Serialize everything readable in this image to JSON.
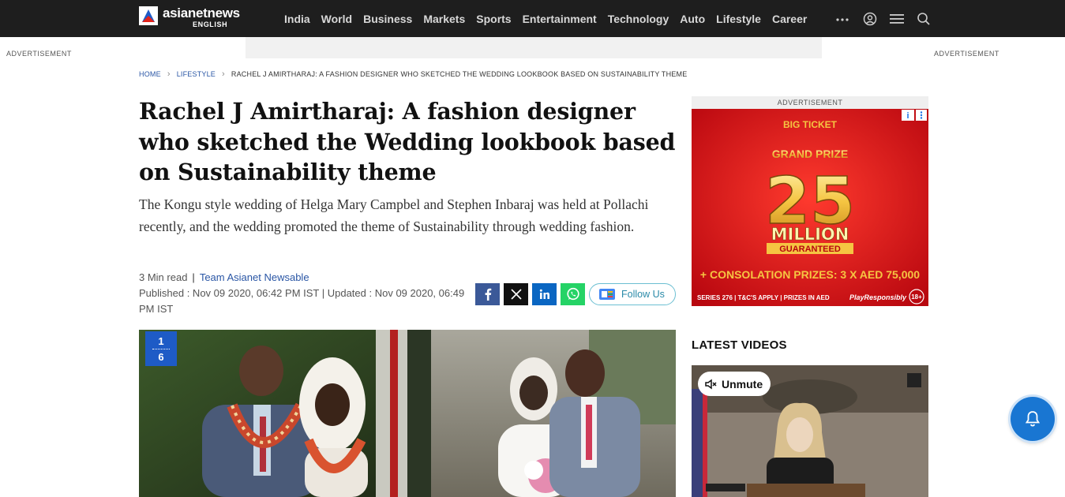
{
  "header": {
    "brand": "asianetnews",
    "brand_sub": "ENGLISH",
    "nav": [
      "India",
      "World",
      "Business",
      "Markets",
      "Sports",
      "Entertainment",
      "Technology",
      "Auto",
      "Lifestyle",
      "Career"
    ],
    "icons": [
      "more-icon",
      "user-icon",
      "menu-icon",
      "search-icon"
    ]
  },
  "ads": {
    "left_label": "ADVERTISEMENT",
    "right_label": "ADVERTISEMENT",
    "sidebar_label": "ADVERTISEMENT",
    "sidebar_banner": {
      "brand": "BIG TICKET",
      "headline": "GRAND PRIZE",
      "amount": "25",
      "unit": "MILLION",
      "tag": "GUARANTEED",
      "consolation": "+ CONSOLATION PRIZES: 3 X AED 75,000",
      "footer_left": "SERIES 276 | T&C'S APPLY | PRIZES IN AED",
      "footer_right": "PlayResponsibly",
      "age": "18+"
    }
  },
  "breadcrumb": {
    "home": "HOME",
    "section": "LIFESTYLE",
    "current": "RACHEL J AMIRTHARAJ: A FASHION DESIGNER WHO SKETCHED THE WEDDING LOOKBOOK BASED ON SUSTAINABILITY THEME"
  },
  "article": {
    "title": "Rachel J Amirtharaj: A fashion designer who sketched the Wedding lookbook based on Sustainability theme",
    "summary": "The Kongu style wedding of Helga Mary Campbel and Stephen Inbaraj was held at Pollachi recently, and the wedding promoted the theme of Sustainability through wedding fashion.",
    "read_time": "3 Min read",
    "author": "Team Asianet Newsable",
    "published": "Published : Nov 09 2020, 06:42 PM IST | Updated : Nov 09 2020, 06:49 PM IST",
    "follow_label": "Follow Us",
    "gallery_current": "1",
    "gallery_total": "6"
  },
  "sidebar": {
    "latest_heading": "LATEST VIDEOS",
    "unmute_label": "Unmute"
  },
  "colors": {
    "header_bg": "#1e1e1e",
    "link": "#2a56a5",
    "facebook": "#3b5998",
    "linkedin": "#0a66c2",
    "whatsapp": "#25d366",
    "ad_red": "#d8141c",
    "gold": "#f5c542",
    "bell": "#1976d2"
  }
}
